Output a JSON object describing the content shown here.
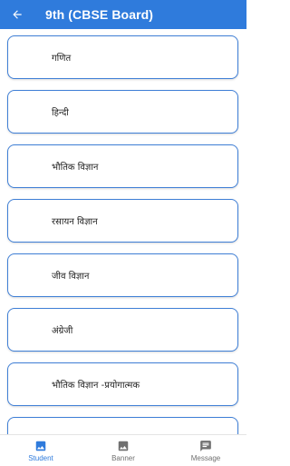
{
  "header": {
    "title": "9th (CBSE Board)",
    "back_icon": "arrow-left-icon"
  },
  "subjects": [
    {
      "label": "गणित"
    },
    {
      "label": "हिन्दी"
    },
    {
      "label": "भौतिक विज्ञान"
    },
    {
      "label": "रसायन विज्ञान"
    },
    {
      "label": "जीव विज्ञान"
    },
    {
      "label": "अंग्रेजी"
    },
    {
      "label": "भौतिक विज्ञान -प्रयोगात्मक"
    },
    {
      "label": ""
    }
  ],
  "bottom_nav": {
    "items": [
      {
        "label": "Student",
        "icon": "image-icon",
        "active": true
      },
      {
        "label": "Banner",
        "icon": "image-icon",
        "active": false
      },
      {
        "label": "Message",
        "icon": "message-icon",
        "active": false
      }
    ]
  },
  "colors": {
    "primary": "#2f7bdc",
    "card_border": "#3f7fd6",
    "inactive": "#707070"
  }
}
